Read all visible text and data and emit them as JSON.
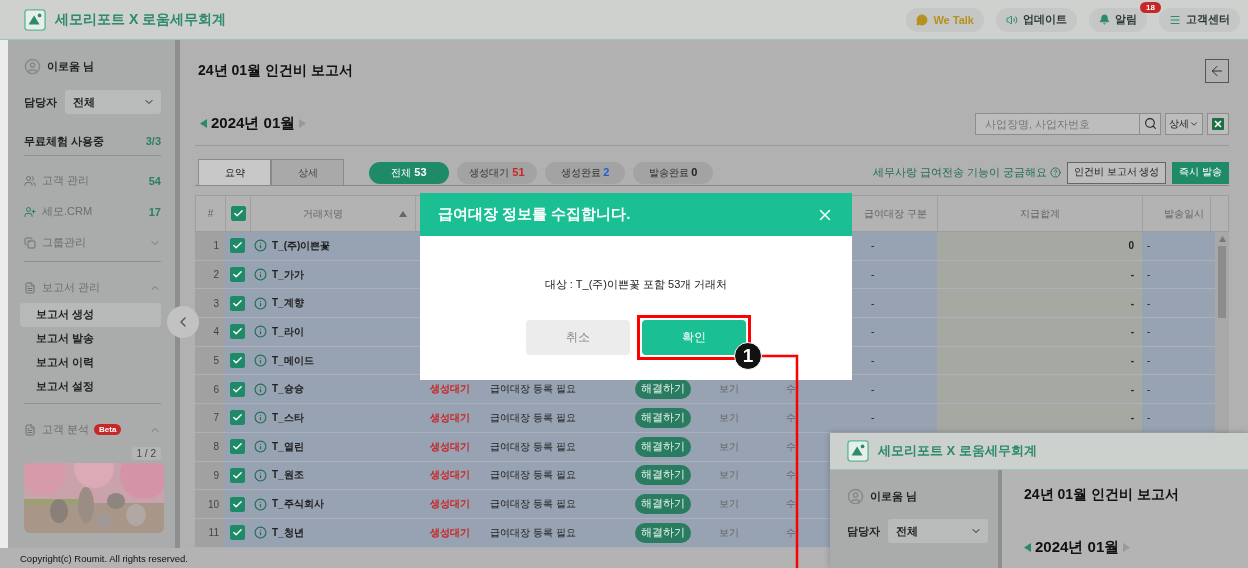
{
  "app": {
    "title": "세모리포트 X 로움세무회계"
  },
  "top_actions": [
    {
      "kind": "talk",
      "label": "We Talk"
    },
    {
      "kind": "update",
      "label": "업데이트"
    },
    {
      "kind": "alarm",
      "label": "알림",
      "badge": "18"
    },
    {
      "kind": "help",
      "label": "고객센터"
    }
  ],
  "sidebar": {
    "user": "이로움 님",
    "manager": {
      "label": "담당자",
      "value": "전체"
    },
    "trial": {
      "label": "무료체험 사용중",
      "count": "3/3"
    },
    "menu": [
      {
        "kind": "customers",
        "label": "고객 관리",
        "count": "54"
      },
      {
        "kind": "crm",
        "label": "세모.CRM",
        "count": "17"
      },
      {
        "kind": "group",
        "label": "그룹관리",
        "expanded": false
      },
      {
        "kind": "report",
        "label": "보고서 관리",
        "expanded": true,
        "children": [
          {
            "label": "보고서 생성",
            "selected": true
          },
          {
            "label": "보고서 발송",
            "selected": false
          },
          {
            "label": "보고서 이력",
            "selected": false
          },
          {
            "label": "보고서 설정",
            "selected": false
          }
        ]
      },
      {
        "kind": "analysis",
        "label": "고객 분석",
        "badge": "Beta",
        "expanded": true
      }
    ],
    "banner": {
      "kind": "picture",
      "pager": "1 / 2"
    }
  },
  "footer": "Copyright(c) Roumit. All rights reserved.",
  "page": {
    "title": "24년 01월 인건비 보고서",
    "month": "2024년 01월",
    "search": {
      "placeholder": "사업장명, 사업자번호"
    },
    "detail_select": "상세",
    "view_tabs": [
      {
        "label": "요약",
        "selected": true
      },
      {
        "label": "상세",
        "selected": false
      }
    ],
    "filters": [
      {
        "label": "전체",
        "count": "53",
        "selected": true,
        "color": "#ffffff"
      },
      {
        "label": "생성대기",
        "count": "51",
        "selected": false,
        "color": "#c62828"
      },
      {
        "label": "생성완료",
        "count": "2",
        "selected": false,
        "color": "#1e62c8"
      },
      {
        "label": "발송완료",
        "count": "0",
        "selected": false,
        "color": "#222222"
      }
    ],
    "help_link": "세무사랑 급여전송 기능이 궁금해요",
    "buttons": [
      {
        "kind": "outline",
        "label": "인건비 보고서 생성"
      },
      {
        "kind": "primary",
        "label": "즉시 발송"
      }
    ]
  },
  "table": {
    "header": {
      "num": "#",
      "all_checked": true,
      "name": "거래처명",
      "sort_ascending": true,
      "division": "급여대장 구분",
      "total": "지급합계",
      "sent": "발송일시"
    },
    "rows": [
      {
        "num": "1",
        "checked": true,
        "name": "T_(주)이쁜꽃",
        "division": "-",
        "total": "0",
        "sent": "-"
      },
      {
        "num": "2",
        "checked": true,
        "name": "T_가가",
        "division": "-",
        "total": "-",
        "sent": "-"
      },
      {
        "num": "3",
        "checked": true,
        "name": "T_계향",
        "division": "-",
        "total": "-",
        "sent": "-"
      },
      {
        "num": "4",
        "checked": true,
        "name": "T_라이",
        "division": "-",
        "total": "-",
        "sent": "-"
      },
      {
        "num": "5",
        "checked": true,
        "name": "T_메이드",
        "division": "-",
        "total": "-",
        "sent": "-"
      },
      {
        "num": "6",
        "checked": true,
        "name": "T_슝슝",
        "status": "생성대기",
        "reason": "급여대장 등록 필요",
        "action": "해결하기",
        "view": "보기",
        "edit": "수",
        "division": "-",
        "total": "-",
        "sent": "-"
      },
      {
        "num": "7",
        "checked": true,
        "name": "T_스타",
        "status": "생성대기",
        "reason": "급여대장 등록 필요",
        "action": "해결하기",
        "view": "보기",
        "edit": "수",
        "division": "-",
        "total": "-",
        "sent": "-"
      },
      {
        "num": "8",
        "checked": true,
        "name": "T_열린",
        "status": "생성대기",
        "reason": "급여대장 등록 필요",
        "action": "해결하기",
        "view": "보기",
        "edit": "수"
      },
      {
        "num": "9",
        "checked": true,
        "name": "T_원조",
        "status": "생성대기",
        "reason": "급여대장 등록 필요",
        "action": "해결하기",
        "view": "보기",
        "edit": "수"
      },
      {
        "num": "10",
        "checked": true,
        "name": "T_주식회사",
        "status": "생성대기",
        "reason": "급여대장 등록 필요",
        "action": "해결하기",
        "view": "보기",
        "edit": "수"
      },
      {
        "num": "11",
        "checked": true,
        "name": "T_청년",
        "status": "생성대기",
        "reason": "급여대장 등록 필요",
        "action": "해결하기",
        "view": "보기",
        "edit": "수"
      }
    ]
  },
  "modal": {
    "title": "급여대장 정보를 수집합니다.",
    "message": "대상 : T_(주)이쁜꽃 포함 53개 거래처",
    "buttons": [
      {
        "kind": "cancel",
        "label": "취소",
        "highlighted": false
      },
      {
        "kind": "confirm",
        "label": "확인",
        "highlighted": true
      }
    ]
  },
  "callout": {
    "number": "1"
  },
  "inset": {
    "title": "세모리포트 X 로움세무회계",
    "user": "이로움 님",
    "manager_label": "담당자",
    "manager_value": "전체",
    "page_title": "24년 01월 인건비 보고서",
    "month": "2024년 01월"
  }
}
